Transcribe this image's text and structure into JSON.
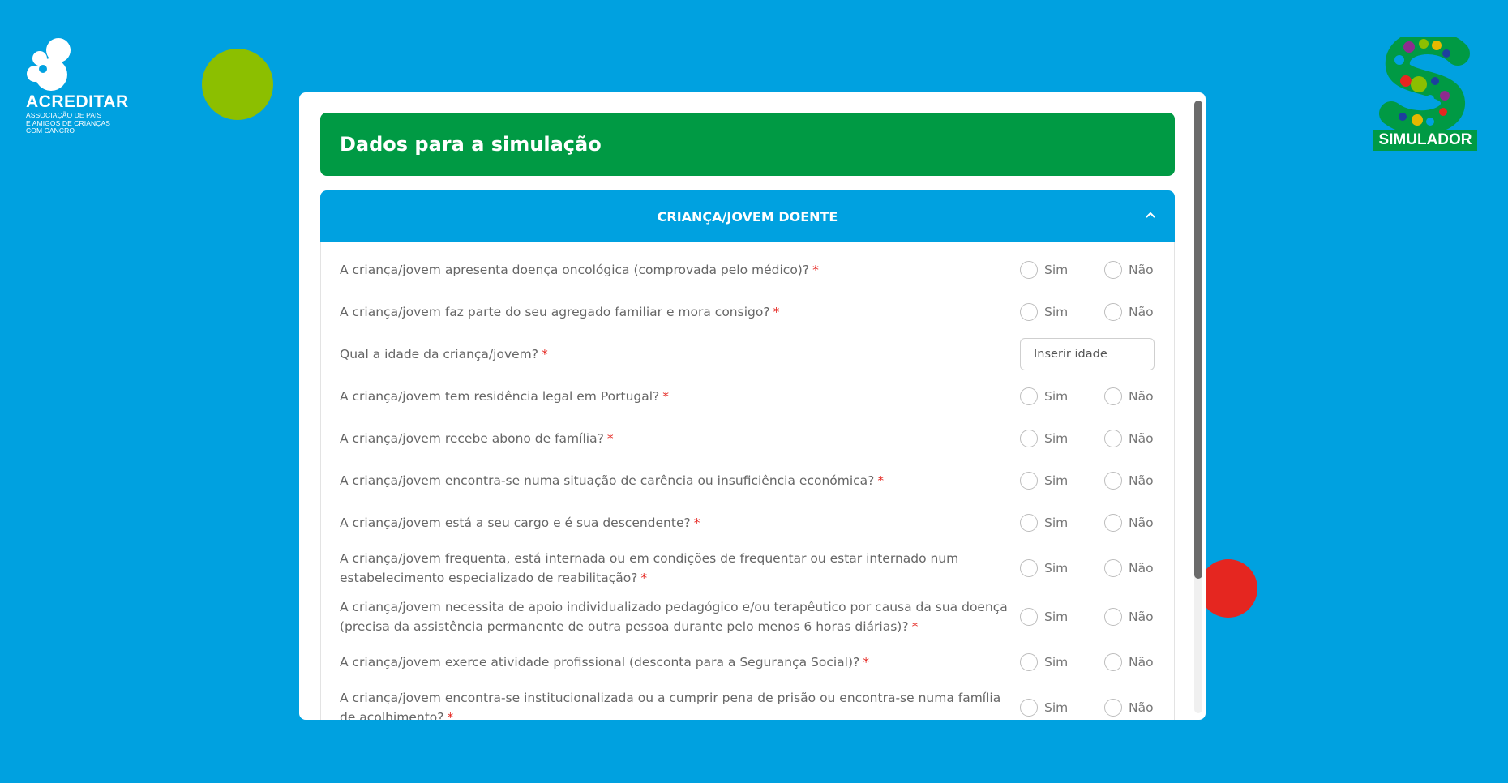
{
  "brand": {
    "name": "ACREDITAR",
    "tagline": [
      "ASSOCIAÇÃO DE PAIS",
      "E AMIGOS DE CRIANÇAS",
      "COM CANCRO"
    ],
    "simulator_label": "SIMULADOR"
  },
  "colors": {
    "background": "#00a1e0",
    "title_bar": "#009a44",
    "section_header": "#00a1e0",
    "required": "#e52620",
    "deco_green": "#8cbf00",
    "deco_red": "#e52620"
  },
  "title": "Dados para a simulação",
  "section": {
    "label": "CRIANÇA/JOVEM DOENTE",
    "toggle_icon": "chevron-up-icon"
  },
  "options": {
    "yes": "Sim",
    "no": "Não"
  },
  "age": {
    "placeholder": "Inserir idade"
  },
  "questions": [
    {
      "text": "A criança/jovem apresenta doença oncológica (comprovada pelo médico)?",
      "required": "*"
    },
    {
      "text": "A criança/jovem faz parte do seu agregado familiar e mora consigo?",
      "required": "*"
    },
    {
      "text": "Qual a idade da criança/jovem?",
      "required": "*"
    },
    {
      "text": "A criança/jovem tem residência legal em Portugal?",
      "required": "*"
    },
    {
      "text": "A criança/jovem recebe abono de família?",
      "required": "*"
    },
    {
      "text": "A criança/jovem encontra-se numa situação de carência ou insuficiência económica?",
      "required": "*"
    },
    {
      "text": "A criança/jovem está a seu cargo e é sua descendente?",
      "required": "*"
    },
    {
      "text": "A criança/jovem frequenta, está internada ou em condições de frequentar ou estar internado num estabelecimento especializado de reabilitação?",
      "required": "*"
    },
    {
      "text": "A criança/jovem necessita de apoio individualizado pedagógico e/ou terapêutico por causa da sua doença (precisa da assistência permanente de outra pessoa durante pelo menos 6 horas diárias)?",
      "required": "*"
    },
    {
      "text": "A criança/jovem exerce atividade profissional (desconta para a Segurança Social)?",
      "required": "*"
    },
    {
      "text": "A criança/jovem encontra-se institucionalizada ou a cumprir pena de prisão ou encontra-se numa família de acolhimento?",
      "required": "*"
    }
  ]
}
